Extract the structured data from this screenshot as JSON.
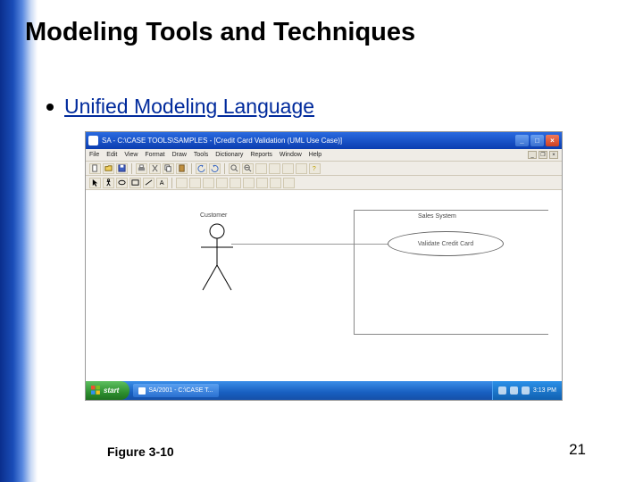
{
  "slide": {
    "title": "Modeling Tools and Techniques",
    "bullet": "Unified Modeling Language",
    "figure_label": "Figure 3-10",
    "page_number": "21"
  },
  "window": {
    "title": "SA - C:\\CASE TOOLS\\SAMPLES - [Credit Card Validation (UML Use Case)]",
    "menus": [
      "File",
      "Edit",
      "View",
      "Format",
      "Draw",
      "Tools",
      "Dictionary",
      "Reports",
      "Window",
      "Help"
    ],
    "min_icon": "_",
    "max_icon": "□",
    "close_icon": "×"
  },
  "diagram": {
    "actor_label": "Customer",
    "system_label": "Sales System",
    "usecase_label": "Validate Credit Card"
  },
  "taskbar": {
    "start": "start",
    "items": [
      "SA/2001 - C:\\CASE T..."
    ],
    "clock": "3:13 PM"
  }
}
